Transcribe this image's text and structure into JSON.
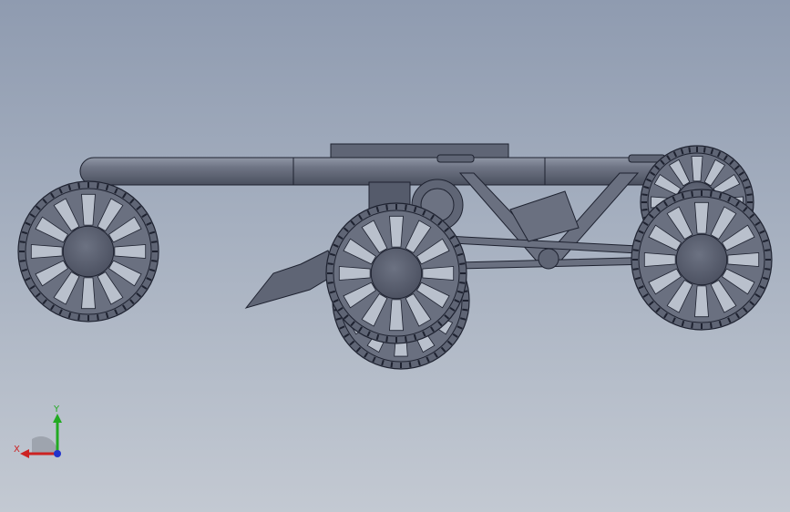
{
  "view": {
    "background_top": "#8f9bb0",
    "background_bottom": "#c3c9d2"
  },
  "model": {
    "part_color": "#5f6575",
    "part_highlight": "#8a90a0",
    "edge_color": "#1e2230"
  },
  "triad": {
    "x_label": "X",
    "y_label": "Y",
    "x_color": "#cc2222",
    "y_color": "#22aa22",
    "z_color": "#2233cc"
  }
}
